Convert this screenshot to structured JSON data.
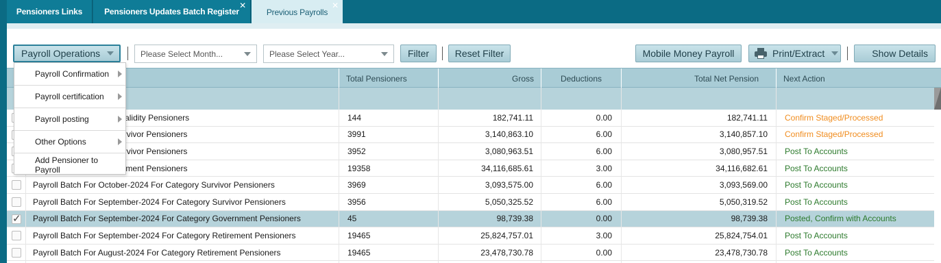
{
  "tabs": [
    {
      "label": "Pensioners Links",
      "closable": false
    },
    {
      "label": "Pensioners Updates Batch Register",
      "closable": true
    },
    {
      "label": "Previous Payrolls",
      "closable": true,
      "active": true
    }
  ],
  "toolbar": {
    "payroll_operations": "Payroll Operations",
    "month_placeholder": "Please Select Month...",
    "year_placeholder": "Please Select Year...",
    "filter": "Filter",
    "reset_filter": "Reset Filter",
    "mobile_money": "Mobile Money Payroll",
    "print_extract": "Print/Extract",
    "show_details": "Show Details"
  },
  "menu": {
    "items": [
      {
        "label": "Payroll Confirmation",
        "submenu": true
      },
      {
        "label": "Payroll certification",
        "submenu": true
      },
      {
        "label": "Payroll posting",
        "submenu": true
      },
      {
        "label": "Other Options",
        "submenu": true
      },
      {
        "label": "Add Pensioner to Payroll",
        "submenu": false
      }
    ]
  },
  "table": {
    "headers": [
      "Total Pensioners",
      "Gross",
      "Deductions",
      "Total Net Pension",
      "Next Action"
    ],
    "rows": [
      {
        "batch": "er-2024 For Category Invalidity Pensioners",
        "total": "144",
        "gross": "182,741.11",
        "deductions": "0.00",
        "net": "182,741.11",
        "next": "Confirm Staged/Processed",
        "status": "orange",
        "checked": false,
        "selected": false
      },
      {
        "batch": "er-2024 For Category Survivor Pensioners",
        "total": "3991",
        "gross": "3,140,863.10",
        "deductions": "6.00",
        "net": "3,140,857.10",
        "next": "Confirm Staged/Processed",
        "status": "orange",
        "checked": false,
        "selected": false
      },
      {
        "batch": "er-2024 For Category Survivor Pensioners",
        "total": "3952",
        "gross": "3,080,963.51",
        "deductions": "6.00",
        "net": "3,080,957.51",
        "next": "Post To Accounts",
        "status": "green",
        "checked": false,
        "selected": false
      },
      {
        "batch": "2024 For Category Retirement Pensioners",
        "total": "19358",
        "gross": "34,116,685.61",
        "deductions": "3.00",
        "net": "34,116,682.61",
        "next": "Post To Accounts",
        "status": "green",
        "checked": false,
        "selected": false
      },
      {
        "batch": "Payroll Batch For October-2024 For Category Survivor Pensioners",
        "total": "3969",
        "gross": "3,093,575.00",
        "deductions": "6.00",
        "net": "3,093,569.00",
        "next": "Post To Accounts",
        "status": "green",
        "checked": false,
        "selected": false
      },
      {
        "batch": "Payroll Batch For September-2024 For Category Survivor Pensioners",
        "total": "3956",
        "gross": "5,050,325.52",
        "deductions": "6.00",
        "net": "5,050,319.52",
        "next": "Post To Accounts",
        "status": "green",
        "checked": false,
        "selected": false
      },
      {
        "batch": "Payroll Batch For September-2024 For Category Government Pensioners",
        "total": "45",
        "gross": "98,739.38",
        "deductions": "0.00",
        "net": "98,739.38",
        "next": "Posted, Confirm with Accounts",
        "status": "green",
        "checked": true,
        "selected": true
      },
      {
        "batch": "Payroll Batch For September-2024 For Category Retirement Pensioners",
        "total": "19465",
        "gross": "25,824,757.01",
        "deductions": "3.00",
        "net": "25,824,754.01",
        "next": "Post To Accounts",
        "status": "green",
        "checked": false,
        "selected": false
      },
      {
        "batch": "Payroll Batch For August-2024 For Category Retirement Pensioners",
        "total": "19465",
        "gross": "23,478,730.78",
        "deductions": "0.00",
        "net": "23,478,730.78",
        "next": "Post To Accounts",
        "status": "green",
        "checked": false,
        "selected": false
      }
    ]
  },
  "colors": {
    "tabbar": "#0b6b84",
    "header": "#a9ccd6",
    "status_orange": "#f08c1e",
    "status_green": "#2c7a2c"
  },
  "icons": {
    "print": "printer-icon",
    "dropdown": "chevron-down-icon",
    "submenu": "chevron-right-icon"
  }
}
